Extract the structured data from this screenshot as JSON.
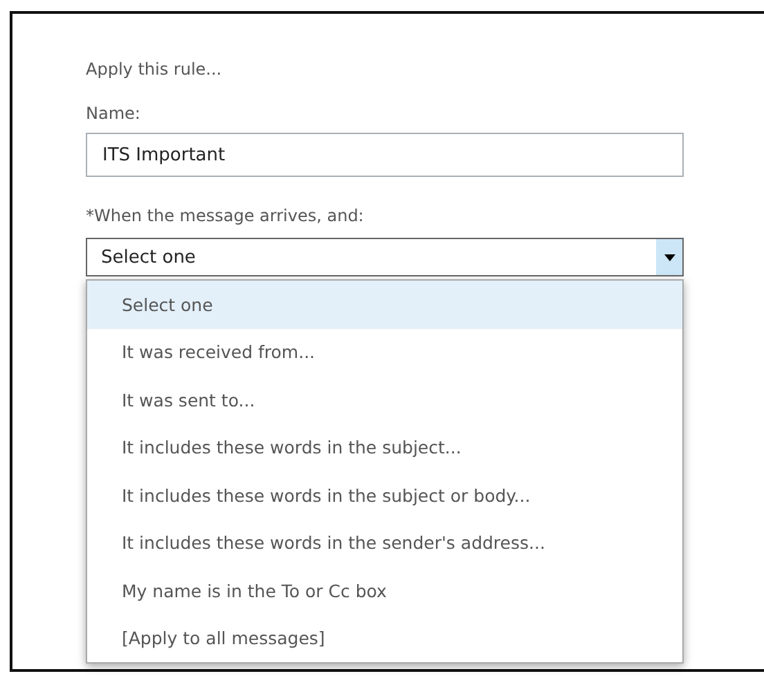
{
  "heading": "Apply this rule...",
  "name_field": {
    "label": "Name:",
    "value": "ITS Important"
  },
  "condition": {
    "label": "*When the message arrives, and:",
    "value": "Select one",
    "expanded": true,
    "options": [
      {
        "label": "Select one",
        "selected": true
      },
      {
        "label": "It was received from...",
        "selected": false
      },
      {
        "label": "It was sent to...",
        "selected": false
      },
      {
        "label": "It includes these words in the subject...",
        "selected": false
      },
      {
        "label": "It includes these words in the subject or body...",
        "selected": false
      },
      {
        "label": "It includes these words in the sender's address...",
        "selected": false
      },
      {
        "label": "My name is in the To or Cc box",
        "selected": false
      },
      {
        "label": "[Apply to all messages]",
        "selected": false
      }
    ]
  }
}
